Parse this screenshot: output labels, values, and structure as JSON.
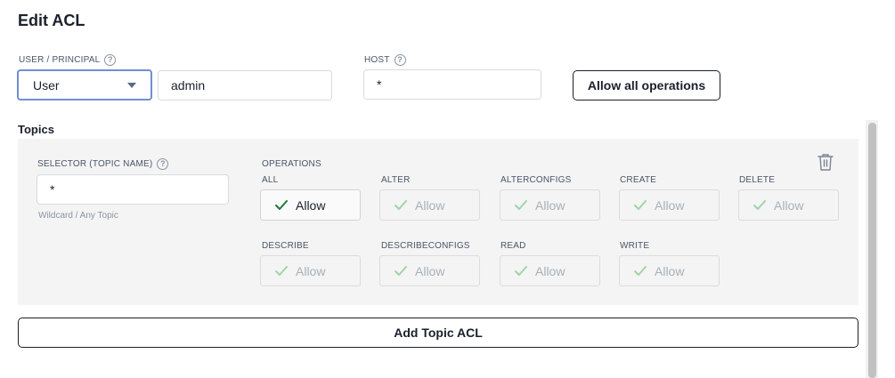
{
  "page": {
    "title": "Edit ACL"
  },
  "principal": {
    "label": "USER / PRINCIPAL",
    "type_value": "User",
    "name_value": "admin"
  },
  "host": {
    "label": "HOST",
    "value": "*"
  },
  "actions": {
    "allow_all_label": "Allow all operations",
    "add_topic_label": "Add Topic ACL"
  },
  "topics": {
    "title": "Topics",
    "selector": {
      "label": "SELECTOR (TOPIC NAME)",
      "value": "*",
      "helper": "Wildcard / Any Topic"
    },
    "operations_label": "OPERATIONS",
    "operations": [
      {
        "name": "ALL",
        "value": "Allow",
        "selected": true
      },
      {
        "name": "ALTER",
        "value": "Allow",
        "selected": false
      },
      {
        "name": "ALTERCONFIGS",
        "value": "Allow",
        "selected": false
      },
      {
        "name": "CREATE",
        "value": "Allow",
        "selected": false
      },
      {
        "name": "DELETE",
        "value": "Allow",
        "selected": false
      },
      {
        "name": "DESCRIBE",
        "value": "Allow",
        "selected": false
      },
      {
        "name": "DESCRIBECONFIGS",
        "value": "Allow",
        "selected": false
      },
      {
        "name": "READ",
        "value": "Allow",
        "selected": false
      },
      {
        "name": "WRITE",
        "value": "Allow",
        "selected": false
      }
    ]
  },
  "icons": {
    "help": "help-circle-icon",
    "dropdown": "chevron-down-icon",
    "delete": "trash-icon",
    "check": "check-icon"
  },
  "colors": {
    "focus_border": "#6e8fd6",
    "check_active": "#1d7a38",
    "check_inactive": "#9fd4a8",
    "panel_bg": "#f4f4f4"
  }
}
